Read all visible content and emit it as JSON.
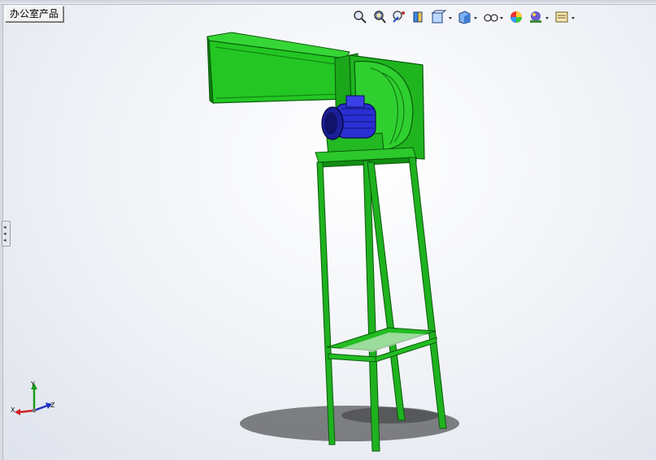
{
  "document": {
    "title": "办公室产品"
  },
  "toolbar": {
    "icons": [
      "zoom-to-fit-icon",
      "zoom-to-area-icon",
      "previous-view-icon",
      "section-view-icon",
      "view-orientation-icon",
      "display-style-icon",
      "hide-show-items-icon",
      "edit-appearance-icon",
      "apply-scene-icon",
      "view-settings-icon"
    ]
  },
  "triad": {
    "x_label": "X",
    "y_label": "Y",
    "z_label": "Z"
  },
  "colors": {
    "model_green": "#1fb21f",
    "motor_blue": "#2a2fd4",
    "background": "#eef0f5"
  }
}
